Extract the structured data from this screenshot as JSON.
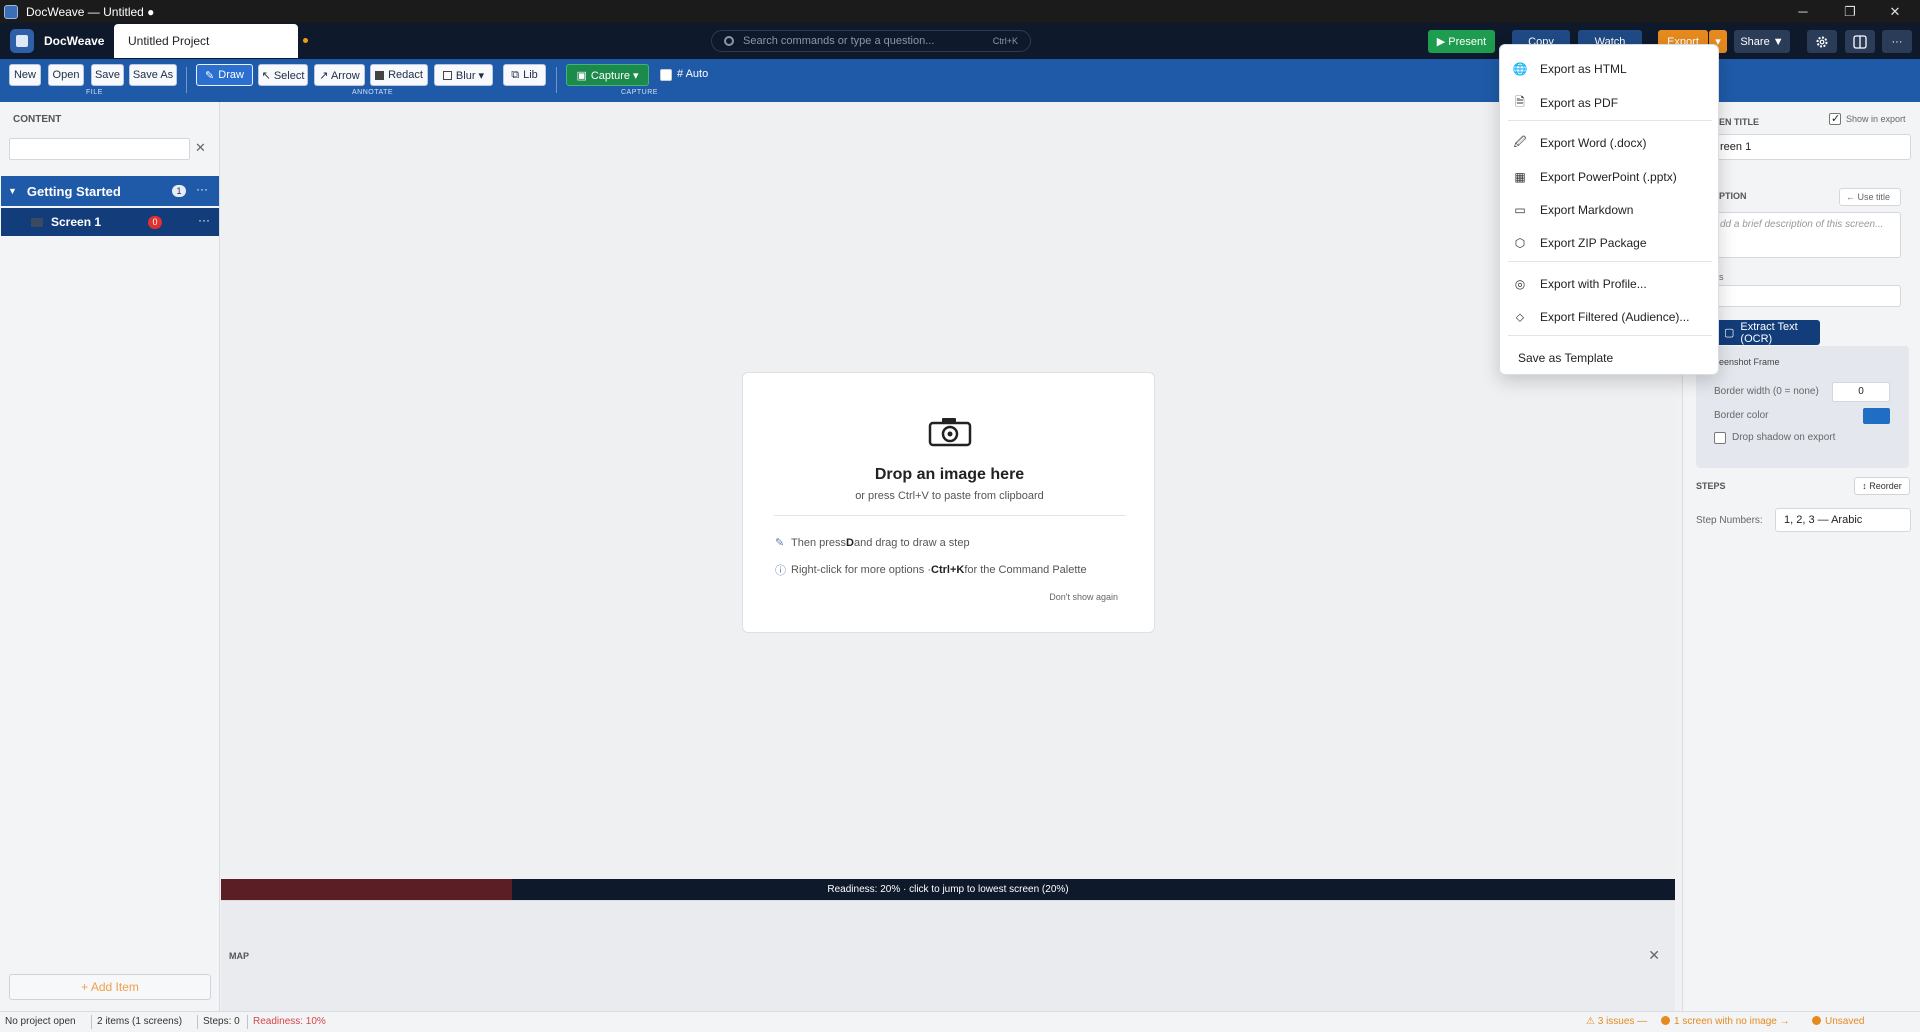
{
  "window": {
    "title": "DocWeave — Untitled ●",
    "controls": {
      "minimize": "─",
      "maximize": "❐",
      "close": "✕"
    }
  },
  "header": {
    "brand": "DocWeave",
    "project_name": "Untitled Project",
    "search_placeholder": "Search commands or type a question...",
    "search_shortcut": "Ctrl+K",
    "present_label": "▶ Present",
    "copy_label": "Copy",
    "watch_label": "Watch",
    "export_label": "Export",
    "export_caret": "▾",
    "share_label": "Share ▼",
    "more_label": "···"
  },
  "toolbar": {
    "new": "New",
    "open": "Open",
    "save": "Save",
    "save_as": "Save As",
    "file_group": "FILE",
    "draw": "Draw",
    "select": "↖ Select",
    "arrow": "↗ Arrow",
    "redact": "Redact",
    "blur": "Blur ▾",
    "lib": "Lib",
    "annotate_group": "ANNOTATE",
    "capture": "Capture ▾",
    "capture_group": "CAPTURE",
    "auto": "# Auto"
  },
  "sidebar": {
    "heading": "CONTENT",
    "clear": "✕",
    "group": {
      "title": "Getting Started",
      "count": "1",
      "more": "···",
      "toggle": "▼"
    },
    "screen": {
      "title": "Screen 1",
      "badge": "0",
      "more": "···"
    },
    "add_item": "+ Add Item"
  },
  "canvas": {
    "drop_title": "Drop an image here",
    "drop_sub": "or press Ctrl+V to paste from clipboard",
    "hint1_a": "Then press ",
    "hint1_key": "D",
    "hint1_b": " and drag to draw a step",
    "hint2_a": "Right-click for more options · ",
    "hint2_key": "Ctrl+K",
    "hint2_b": " for the Command Palette",
    "dont_show": "Don't show again",
    "readiness_text": "Readiness: 20%  ·  click to jump to lowest screen (20%)",
    "readiness_fraction": 0.2,
    "map_label": "MAP",
    "map_close": "✕"
  },
  "right_panel": {
    "screen_title_label": "EN TITLE",
    "show_in_export": "Show in export",
    "screen_title_value": "reen 1",
    "caption_label": "PTION",
    "use_title": "← Use title",
    "caption_placeholder": "dd a brief description of this screen...",
    "tags_label": "s",
    "ocr_label": "Extract Text (OCR)",
    "frame_label": "eenshot Frame",
    "border_width_label": "Border width (0 = none)",
    "border_width_value": "0",
    "border_color_label": "Border color",
    "border_color_value": "#1f6ec4",
    "drop_shadow": "Drop shadow on export",
    "steps_label": "STEPS",
    "reorder": "↕ Reorder",
    "step_numbers_label": "Step Numbers:",
    "step_numbers_value": "1, 2, 3  — Arabic"
  },
  "export_menu": {
    "items": [
      {
        "icon": "globe-icon",
        "glyph": "🌐",
        "label": "Export as HTML"
      },
      {
        "icon": "pdf-icon",
        "glyph": "🗎",
        "label": "Export as PDF"
      },
      {
        "icon": "word-icon",
        "glyph": "🖉",
        "label": "Export Word (.docx)"
      },
      {
        "icon": "powerpoint-icon",
        "glyph": "▦",
        "label": "Export PowerPoint (.pptx)"
      },
      {
        "icon": "markdown-icon",
        "glyph": "▭",
        "label": "Export Markdown"
      },
      {
        "icon": "zip-icon",
        "glyph": "⬡",
        "label": "Export ZIP Package"
      },
      {
        "icon": "profile-icon",
        "glyph": "◎",
        "label": "Export with Profile..."
      },
      {
        "icon": "filter-icon",
        "glyph": "⬦",
        "label": "Export Filtered (Audience)..."
      },
      {
        "icon": "",
        "glyph": "",
        "label": "Save as Template"
      }
    ]
  },
  "statusbar": {
    "project": "No project open",
    "items": "2 items  (1 screens)",
    "steps": "Steps: 0",
    "readiness": "Readiness: 10%",
    "issues": "⚠ 3 issues —",
    "no_image": "1 screen with no image →",
    "unsaved": "Unsaved"
  },
  "colors": {
    "accent": "#1f5aa8",
    "header": "#0e1a2b",
    "present": "#1e9c4f",
    "export": "#e68a1e",
    "badge": "#e03131"
  }
}
